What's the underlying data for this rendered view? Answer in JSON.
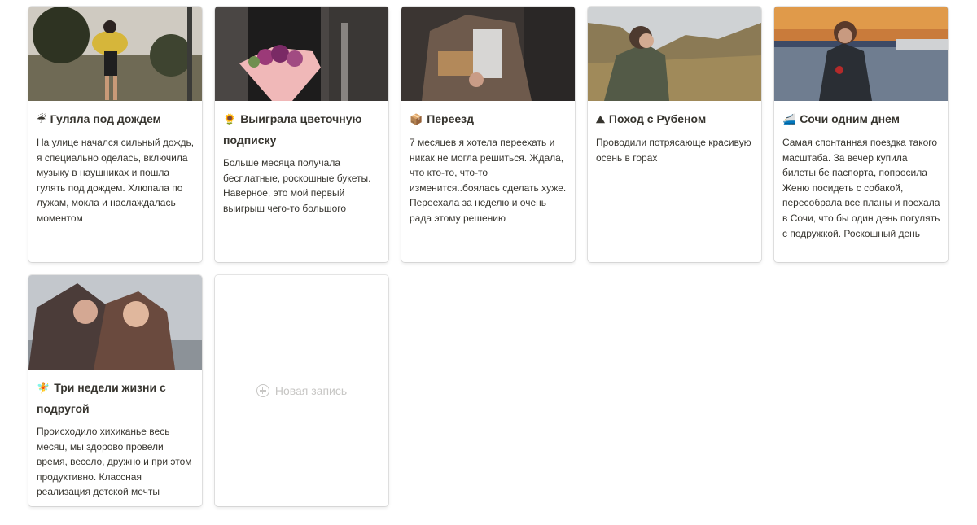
{
  "cards": [
    {
      "emoji": "☔",
      "title": "Гуляла под дождем",
      "description": "На улице начался сильный дождь, я специально оделась, включила музыку в наушниках и пошла гулять под дождем. Хлюпала по лужам, мокла и наслаждалась моментом"
    },
    {
      "emoji": "🌻",
      "title": "Выиграла цветочную подписку",
      "description": "Больше месяца получала бесплатные, роскошные букеты. Наверное, это мой первый выигрыш чего-то большого"
    },
    {
      "emoji": "📦",
      "title": "Переезд",
      "description": "7 месяцев я хотела переехать и никак не могла решиться. Ждала, что кто-то, что-то изменится..боялась сделать хуже. Переехала за неделю и очень рада этому решению"
    },
    {
      "emoji": "⛰",
      "title": "Поход с Рубеном",
      "description": "Проводили потрясающе красивую осень в горах"
    },
    {
      "emoji": "🚄",
      "title": "Сочи одним днем",
      "description": "Самая спонтанная поездка такого масштаба. За вечер купила билеты бе паспорта, попросила Женю посидеть с собакой, пересобрала все планы и поехала в Сочи, что бы один день погулять с подружкой. Роскошный день"
    },
    {
      "emoji": "🧚",
      "title": "Три недели жизни с подругой",
      "description": "Происходило хихиканье весь месяц, мы здорово провели время, весело, дружно и при этом продуктивно. Классная реализация детской мечты"
    }
  ],
  "new_entry": {
    "label": "Новая запись"
  }
}
